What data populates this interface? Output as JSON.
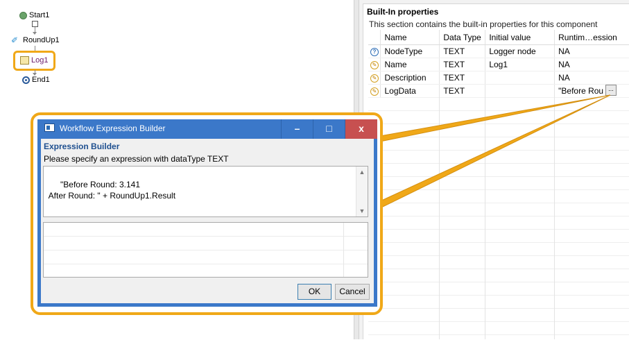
{
  "workflow": {
    "nodes": [
      {
        "label": "Start1",
        "icon": "start-node-icon"
      },
      {
        "label": "RoundUp1",
        "icon": "roundup-node-icon"
      },
      {
        "label": "Log1",
        "icon": "logger-node-icon"
      },
      {
        "label": "End1",
        "icon": "end-node-icon"
      }
    ]
  },
  "properties": {
    "title": "Built-In properties",
    "description": "This section contains the built-in properties for this component",
    "columns": [
      "Name",
      "Data Type",
      "Initial value",
      "Runtim…ession"
    ],
    "rows": [
      {
        "icon": "help-icon",
        "name": "NodeType",
        "type": "TEXT",
        "initial": "Logger node",
        "runtime": "NA"
      },
      {
        "icon": "edit-icon",
        "name": "Name",
        "type": "TEXT",
        "initial": "Log1",
        "runtime": "NA"
      },
      {
        "icon": "edit-icon",
        "name": "Description",
        "type": "TEXT",
        "initial": "",
        "runtime": "NA"
      },
      {
        "icon": "edit-icon",
        "name": "LogData",
        "type": "TEXT",
        "initial": "",
        "runtime": "\"Before Rou"
      }
    ],
    "ellipsis_label": "..."
  },
  "dialog": {
    "title": "Workflow Expression Builder",
    "minimize": "–",
    "maximize": "□",
    "close": "x",
    "section_title": "Expression Builder",
    "instruction": "Please specify an expression with dataType TEXT",
    "expression": "\"Before Round: 3.141\n After Round: \" + RoundUp1.Result",
    "ok_label": "OK",
    "cancel_label": "Cancel"
  },
  "colors": {
    "highlight": "#f0a818",
    "titlebar": "#3b78c9",
    "close": "#c75050",
    "section_title": "#1e4f8f"
  }
}
